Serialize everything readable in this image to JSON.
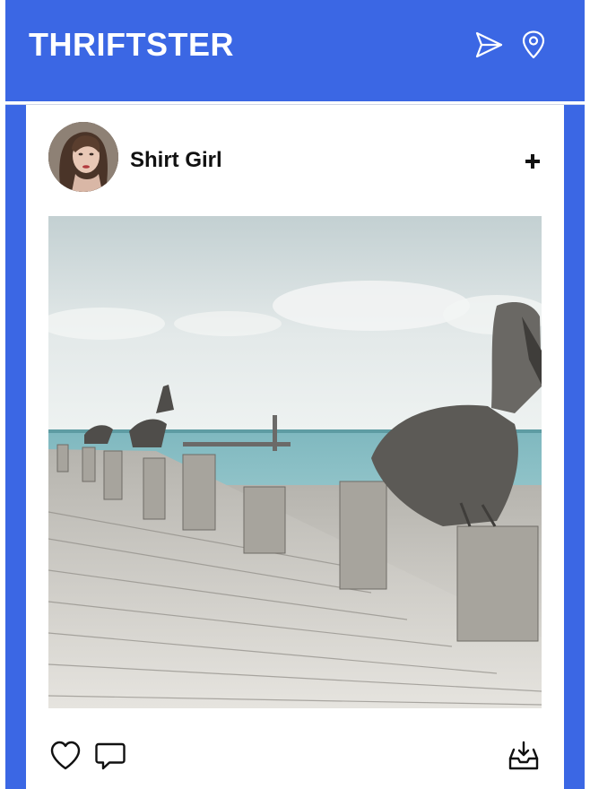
{
  "app": {
    "title": "THRIFTSTER",
    "accent_color": "#3b67e4"
  },
  "header": {
    "send_icon": "send-icon",
    "location_icon": "location-pin-icon"
  },
  "post": {
    "author": "Shirt Girl",
    "follow_icon": "plus-icon",
    "photo_subject": "pelicans-on-wooden-pier",
    "actions": {
      "like_icon": "heart-icon",
      "comment_icon": "comment-bubble-icon",
      "save_icon": "inbox-download-icon"
    }
  }
}
